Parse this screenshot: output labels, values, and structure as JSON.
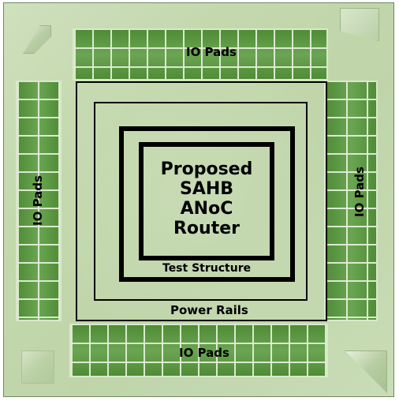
{
  "die": {
    "top_pads_label": "IO Pads",
    "bottom_pads_label": "IO Pads",
    "left_pads_label": "IO Pads",
    "right_pads_label": "IO Pads",
    "power_rails_label": "Power Rails",
    "test_structure_label": "Test Structure",
    "router_lines": [
      "Proposed",
      "SAHB",
      "ANoC",
      "Router"
    ]
  },
  "colors": {
    "die_background": "#c3d8ad",
    "pad_fill": "#6aa050",
    "pad_grid": "#e1eed6",
    "outline": "#000000",
    "text": "#000000"
  }
}
